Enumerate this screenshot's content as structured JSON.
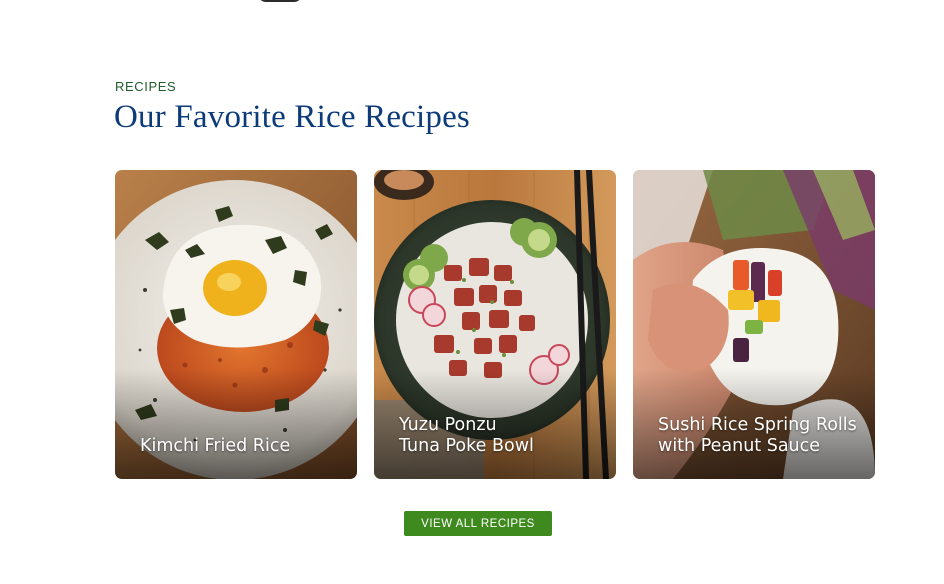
{
  "section": {
    "eyebrow": "RECIPES",
    "title": "Our Favorite Rice Recipes"
  },
  "cards": [
    {
      "title_lines": [
        "Kimchi Fried Rice"
      ],
      "image": "kimchi-fried-rice-photo"
    },
    {
      "title_lines": [
        "Yuzu Ponzu",
        "Tuna Poke Bowl"
      ],
      "image": "tuna-poke-bowl-photo"
    },
    {
      "title_lines": [
        "Sushi Rice Spring Rolls",
        "with Peanut Sauce"
      ],
      "image": "spring-rolls-photo"
    }
  ],
  "cta": {
    "label": "VIEW ALL RECIPES"
  },
  "colors": {
    "eyebrow": "#1f5c2b",
    "title": "#0d3b7a",
    "button": "#3f8a1f"
  }
}
